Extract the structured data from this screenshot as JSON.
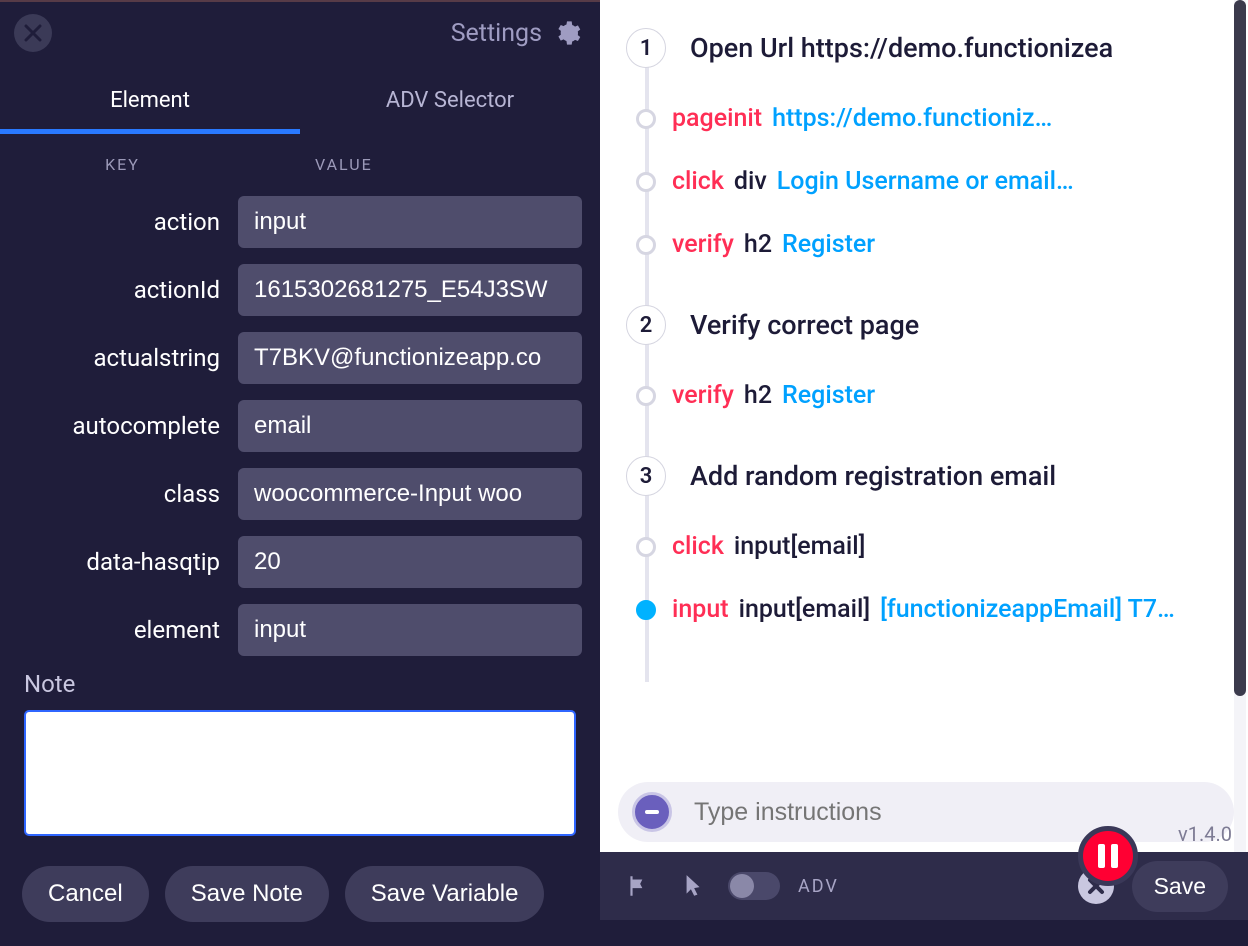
{
  "left": {
    "settings_label": "Settings",
    "tabs": {
      "element": "Element",
      "adv": "ADV Selector"
    },
    "kv_headers": {
      "key": "KEY",
      "value": "VALUE"
    },
    "rows": [
      {
        "key": "action",
        "value": "input"
      },
      {
        "key": "actionId",
        "value": "1615302681275_E54J3SW"
      },
      {
        "key": "actualstring",
        "value": "T7BKV@functionizeapp.co"
      },
      {
        "key": "autocomplete",
        "value": "email"
      },
      {
        "key": "class",
        "value": "woocommerce-Input woo"
      },
      {
        "key": "data-hasqtip",
        "value": "20"
      },
      {
        "key": "element",
        "value": "input"
      }
    ],
    "note_label": "Note",
    "note_value": "",
    "buttons": {
      "cancel": "Cancel",
      "save_note": "Save Note",
      "save_variable": "Save Variable"
    }
  },
  "right": {
    "steps": [
      {
        "num": "1",
        "title": "Open Url https://demo.functionizea",
        "subs": [
          {
            "action": "pageinit",
            "elem": "",
            "target": "https://demo.functioniz…",
            "active": false
          },
          {
            "action": "click",
            "elem": "div",
            "target": "Login Username or email…",
            "active": false
          },
          {
            "action": "verify",
            "elem": "h2",
            "target": "Register",
            "active": false
          }
        ]
      },
      {
        "num": "2",
        "title": "Verify correct page",
        "subs": [
          {
            "action": "verify",
            "elem": "h2",
            "target": "Register",
            "active": false
          }
        ]
      },
      {
        "num": "3",
        "title": "Add random registration email",
        "subs": [
          {
            "action": "click",
            "elem": "input[email]",
            "target": "",
            "active": false
          },
          {
            "action": "input",
            "elem": "input[email]",
            "target": "[functionizeappEmail] T7…",
            "active": true
          }
        ]
      }
    ],
    "instructions_placeholder": "Type instructions",
    "adv_label": "ADV",
    "save_label": "Save",
    "version": "v1.4.0"
  }
}
